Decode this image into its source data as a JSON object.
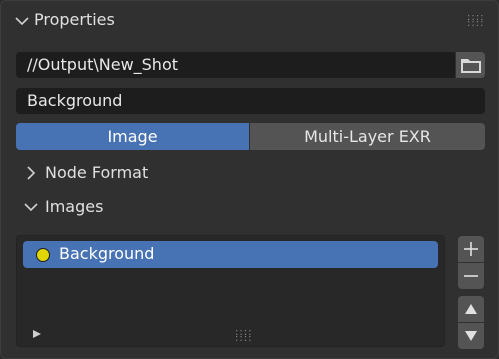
{
  "panel": {
    "title": "Properties",
    "header_icon": "chevron-down-icon",
    "grip_icon": "drag-grip-icon"
  },
  "output": {
    "path": "//Output\\New_Shot",
    "browse_icon": "folder-icon",
    "name": "Background"
  },
  "format_toggle": {
    "options": [
      "Image",
      "Multi-Layer EXR"
    ],
    "selected": "Image"
  },
  "sections": {
    "node_format": {
      "label": "Node Format",
      "expanded": false
    },
    "images": {
      "label": "Images",
      "expanded": true
    }
  },
  "images_list": {
    "items": [
      {
        "label": "Background",
        "selected": true,
        "dot_color": "#e0d600"
      }
    ],
    "buttons": [
      "plus-icon",
      "minus-icon",
      "triangle-up-icon",
      "triangle-down-icon"
    ]
  },
  "colors": {
    "accent": "#4772b3",
    "panel_bg": "#303030",
    "field_bg": "#1d1d1d",
    "button_bg": "#545454"
  }
}
